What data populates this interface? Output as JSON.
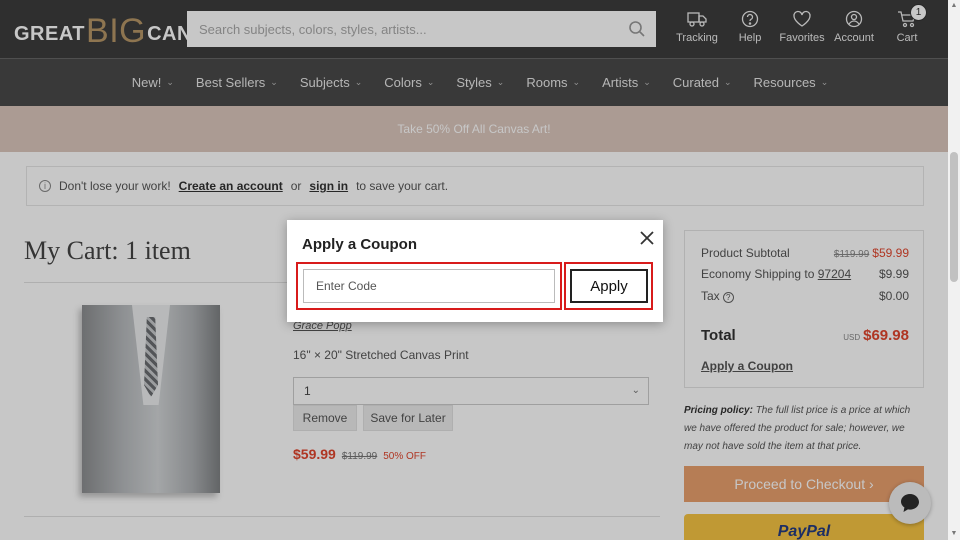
{
  "header": {
    "logo": {
      "great": "GREAT",
      "big": "BIG",
      "canvas": "CANVAS",
      "reg": "®"
    },
    "search_placeholder": "Search subjects, colors, styles, artists...",
    "items": [
      {
        "label": "Tracking",
        "icon": "truck-icon"
      },
      {
        "label": "Help",
        "icon": "help-icon"
      },
      {
        "label": "Favorites",
        "icon": "heart-icon"
      },
      {
        "label": "Account",
        "icon": "user-icon"
      },
      {
        "label": "Cart",
        "icon": "cart-icon"
      }
    ],
    "cart_count": "1"
  },
  "nav": {
    "items": [
      "New!",
      "Best Sellers",
      "Subjects",
      "Colors",
      "Styles",
      "Rooms",
      "Artists",
      "Curated",
      "Resources"
    ],
    "chevron": "⌄"
  },
  "promo": {
    "text": "Take 50% Off All Canvas Art!"
  },
  "notice": {
    "prefix": "Don't lose your work!",
    "create_link": "Create an account",
    "or": "or",
    "signin_link": "sign in",
    "suffix": "to save your cart."
  },
  "cart": {
    "title": "My Cart: 1 item",
    "item": {
      "artist": "Grace Popp",
      "size": "16\" × 20\" Stretched Canvas Print",
      "qty": "1",
      "remove_label": "Remove",
      "save_label": "Save for Later",
      "price": "$59.99",
      "old_price": "$119.99",
      "discount": "50% OFF"
    }
  },
  "summary": {
    "subtotal_label": "Product Subtotal",
    "subtotal_old": "$119.99",
    "subtotal_new": "$59.99",
    "shipping_label": "Economy Shipping to",
    "shipping_zip": "97204",
    "shipping_value": "$9.99",
    "tax_label": "Tax",
    "tax_help": "?",
    "tax_value": "$0.00",
    "total_label": "Total",
    "total_currency": "USD",
    "total_value": "$69.98",
    "coupon_link": "Apply a Coupon"
  },
  "policy": {
    "label": "Pricing policy:",
    "text": "The full list price is a price at which we have offered the product for sale; however, we may not have sold the item at that price."
  },
  "checkout": {
    "label": "Proceed to Checkout ›"
  },
  "paypal": {
    "label": "PayPal"
  },
  "modal": {
    "title": "Apply a Coupon",
    "code_placeholder": "Enter Code",
    "apply_label": "Apply"
  },
  "colors": {
    "header_bg": "#3d3d3d",
    "nav_bg": "#4a4a4a",
    "promo_bg": "#dcc7bd",
    "price_red": "#e1462e",
    "checkout_orange": "#e9a06e",
    "paypal_yellow": "#f7c543",
    "highlight_red": "#d81b1b",
    "logo_gold": "#b79767"
  }
}
